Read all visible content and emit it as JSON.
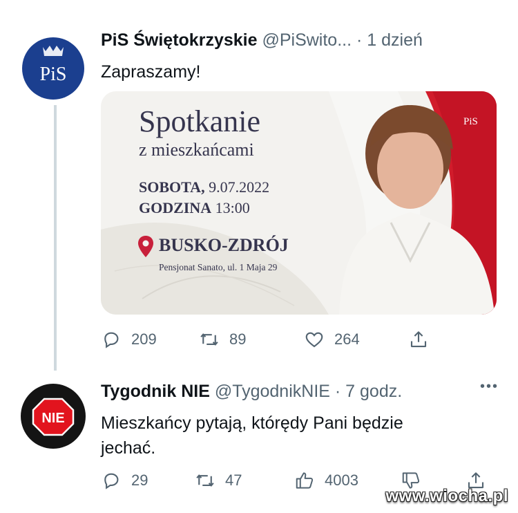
{
  "tweet1": {
    "name": "PiS Świętokrzyskie",
    "handle": "@PiSwito...",
    "time": "· 1 dzień",
    "text": "Zapraszamy!",
    "card": {
      "title": "Spotkanie",
      "subtitle": "z mieszkańcami",
      "line1_label": "SOBOTA,",
      "line1_value": " 9.07.2022",
      "line2_label": "GODZINA",
      "line2_value": " 13:00",
      "town": "BUSKO-ZDRÓJ",
      "address": "Pensjonat Sanato, ul. 1 Maja 29",
      "brand": "PiS"
    },
    "replies": "209",
    "retweets": "89",
    "likes": "264"
  },
  "tweet2": {
    "name": "Tygodnik NIE",
    "handle": "@TygodnikNIE",
    "time": "· 7 godz.",
    "text": "Mieszkańcy pytają, którędy Pani będzie jechać.",
    "replies": "29",
    "retweets": "47",
    "upvotes": "4003"
  },
  "avatar1_text": "PiS",
  "avatar2_text": "NIE",
  "more_label": "•••",
  "watermark": "www.wiocha.pl",
  "colors": {
    "pis_blue": "#1b3f8f",
    "flag_red": "#d11c2b",
    "stop_red": "#e2141e",
    "gray": "#536471"
  },
  "icons": [
    "reply-icon",
    "retweet-icon",
    "like-icon",
    "share-icon",
    "upvote-icon",
    "downvote-icon",
    "more-icon",
    "pin-icon"
  ]
}
